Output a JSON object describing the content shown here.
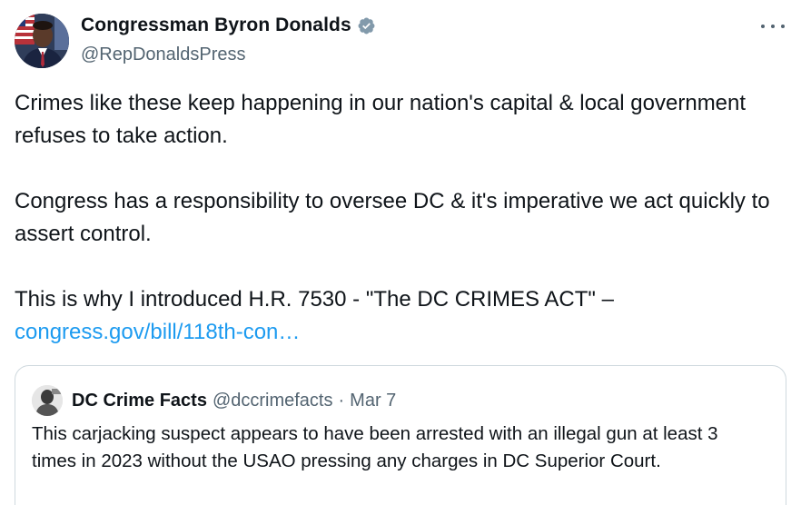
{
  "author": {
    "display_name": "Congressman Byron Donalds",
    "handle": "@RepDonaldsPress",
    "verified": true,
    "verified_color": "#829aab",
    "avatar_icon": "profile-photo"
  },
  "more_icon": "more-options-icon",
  "tweet": {
    "paragraphs": [
      "Crimes like these keep happening in our nation's capital & local government refuses to take action.",
      "Congress has a responsibility to oversee DC & it's imperative we act quickly to assert control.",
      "This is why I introduced H.R. 7530 - \"The DC CRIMES ACT\" –"
    ],
    "link_text": "congress.gov/bill/118th-con…",
    "link_color": "#1d9bf0"
  },
  "quote": {
    "display_name": "DC Crime Facts",
    "handle": "@dccrimefacts",
    "separator": "·",
    "date": "Mar 7",
    "text": "This carjacking suspect appears to have been arrested with an illegal gun at least 3 times in 2023 without the USAO pressing any charges in DC Superior Court."
  },
  "colors": {
    "text": "#0f1419",
    "secondary": "#536471",
    "border": "#cfd9de"
  }
}
